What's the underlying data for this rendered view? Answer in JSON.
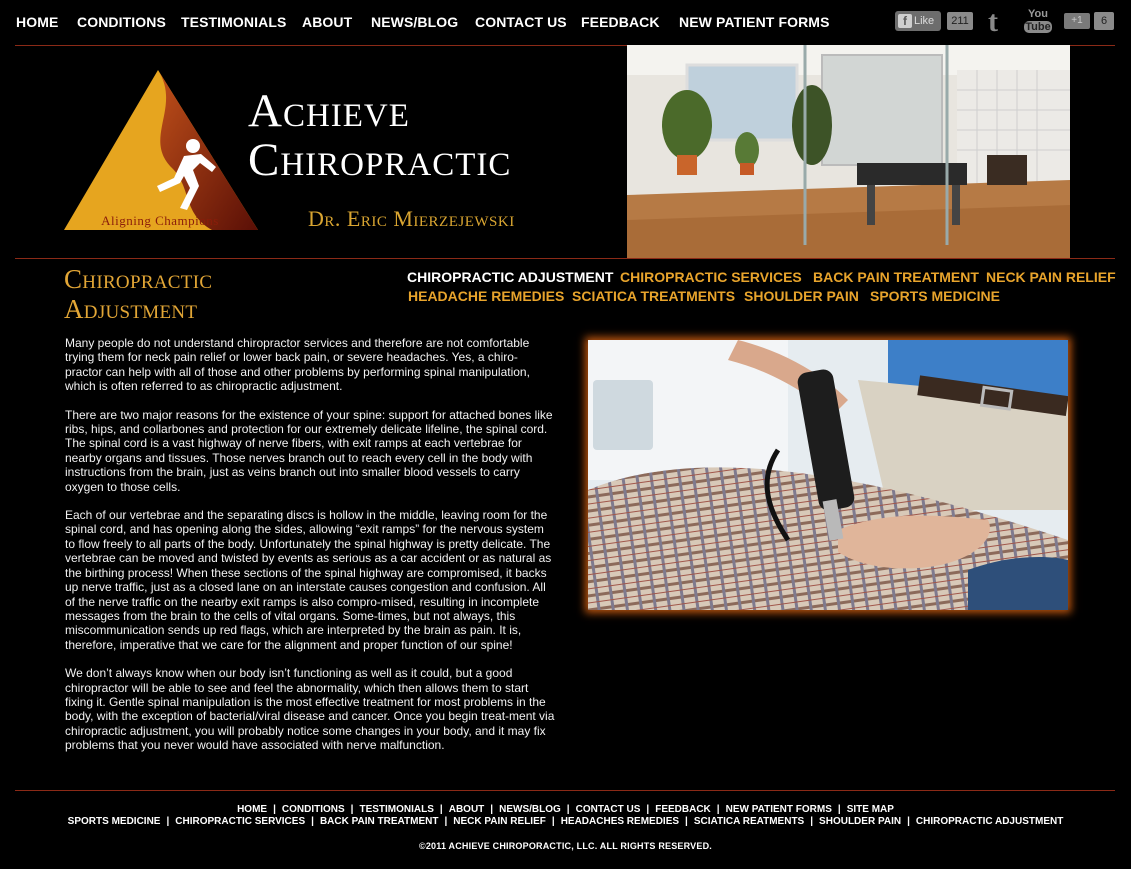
{
  "topnav": {
    "items": [
      "HOME",
      "CONDITIONS",
      "TESTIMONIALS",
      "ABOUT",
      "NEWS/BLOG",
      "CONTACT US",
      "FEEDBACK",
      "NEW PATIENT FORMS"
    ]
  },
  "social": {
    "fb_label": "Like",
    "fb_count": "211",
    "gplus_label": "+1",
    "gplus_count": "6",
    "youtube_top": "You",
    "youtube_bottom": "Tube"
  },
  "header": {
    "brand_line1": "Achieve",
    "brand_line2": "Chiropractic",
    "doctor": "Dr. Eric Mierzejewski",
    "logo_tagline": "Aligning Champions"
  },
  "page": {
    "title_line1": "Chiropractic",
    "title_line2": "Adjustment"
  },
  "subnav": {
    "row1": [
      "CHIROPRACTIC ADJUSTMENT",
      "CHIROPRACTIC SERVICES",
      "BACK PAIN TREATMENT",
      "NECK PAIN RELIEF"
    ],
    "row2": [
      "HEADACHE REMEDIES",
      "SCIATICA TREATMENTS",
      "SHOULDER PAIN",
      "SPORTS MEDICINE"
    ]
  },
  "content": {
    "p1": "Many people do not understand chiropractor services and therefore are not comfortable trying them for neck pain relief or lower back pain, or severe headaches. Yes, a chiro-practor can help with all of those and other problems by performing spinal manipulation, which is often referred to as chiropractic adjustment.",
    "p2": "There are two major reasons for the existence of your spine: support for attached bones like ribs, hips, and collarbones and protection for our extremely delicate lifeline, the spinal cord. The spinal cord is a vast highway of nerve fibers, with exit ramps at each vertebrae for nearby organs and tissues. Those nerves branch out to reach every cell in the body with instructions from the brain, just as veins branch out into smaller blood vessels to carry oxygen to those cells.",
    "p3": "Each of our vertebrae and the separating discs is hollow in the middle, leaving room for the spinal cord, and has opening along the sides, allowing “exit ramps” for the nervous system to flow freely to all parts of the body. Unfortunately the spinal highway is pretty delicate. The vertebrae can be moved and twisted by events as serious as a car accident or as natural as the birthing process! When these sections of the spinal highway are compromised, it backs up nerve traffic, just as a closed lane on an interstate causes congestion and confusion. All of the nerve traffic on the nearby exit ramps is also compro-mised, resulting in incomplete messages from the brain to the cells of vital organs. Some-times, but not always, this miscommunication sends up red flags, which are interpreted by the brain as pain. It is, therefore, imperative that we care for the alignment and proper function of our spine!",
    "p4": "We don’t always know when our body isn’t functioning as well as it could, but a good chiropractor will be able to see and feel the abnormality, which then allows them to start fixing it. Gentle spinal manipulation is the most effective treatment for most problems in the body, with the exception of bacterial/viral disease and cancer. Once you begin treat-ment via chiropractic adjustment, you will probably notice some changes in your body, and it may fix problems that you never would have associated with nerve malfunction."
  },
  "footer": {
    "row1": [
      "HOME",
      "CONDITIONS",
      "TESTIMONIALS",
      "ABOUT",
      "NEWS/BLOG",
      "CONTACT US",
      "FEEDBACK",
      "NEW PATIENT FORMS",
      "SITE MAP"
    ],
    "row2": [
      "SPORTS MEDICINE",
      "CHIROPRACTIC SERVICES",
      "BACK PAIN TREATMENT",
      "NECK PAIN RELIEF",
      "HEADACHES REMEDIES",
      "SCIATICA REATMENTS",
      "SHOULDER PAIN",
      "CHIROPRACTIC ADJUSTMENT"
    ],
    "separator": "|",
    "copyright": "©2011 ACHIEVE CHIROPORACTIC, LLC. ALL RIGHTS RESERVED."
  },
  "colors": {
    "accent_gold": "#e8a42c",
    "rule_red": "#8b2a17",
    "background": "#000000"
  }
}
